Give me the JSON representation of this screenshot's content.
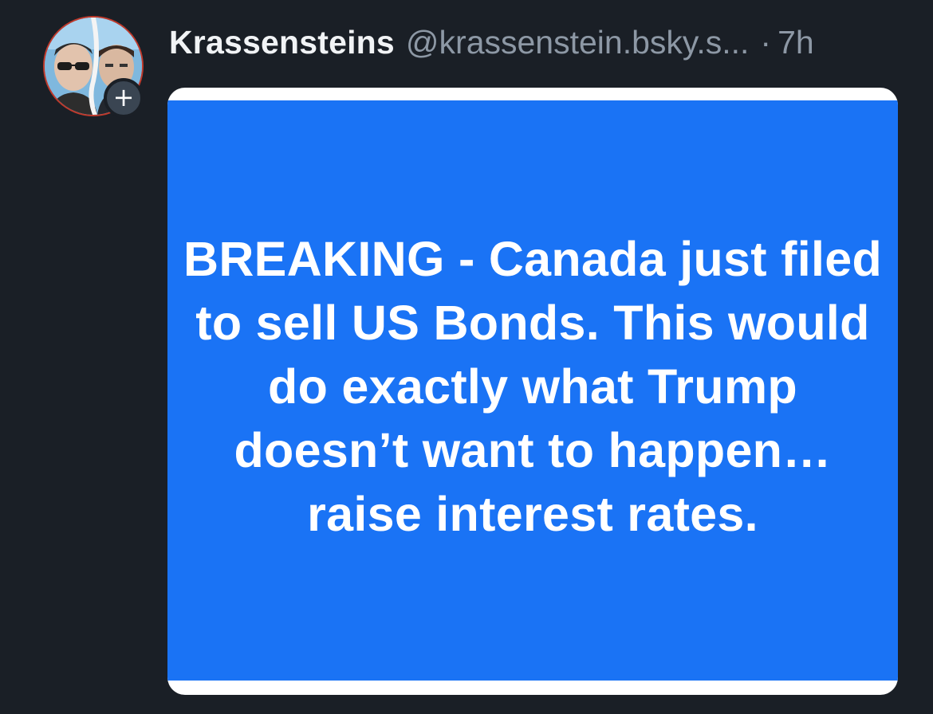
{
  "post": {
    "author": {
      "display_name": "Krassensteins",
      "handle": "@krassenstein.bsky.s...",
      "avatar_icon": "profile-avatar-two-men",
      "follow_icon": "plus-icon",
      "follow_symbol": "+"
    },
    "separator": "·",
    "timestamp": "7h",
    "image": {
      "background_color": "#1a73f5",
      "text": "BREAKING - Canada just filed to sell US Bonds. This would do exactly what Trump doesn’t want to happen…  raise interest rates."
    }
  },
  "colors": {
    "background": "#1a1f26",
    "name": "#f1f3f5",
    "muted": "#8d98a5",
    "image_blue": "#1a73f5"
  }
}
